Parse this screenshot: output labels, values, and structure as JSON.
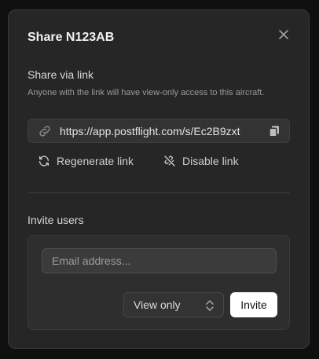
{
  "dialog": {
    "title": "Share N123AB",
    "close_icon": "close-icon"
  },
  "share_link": {
    "heading": "Share via link",
    "description": "Anyone with the link will have view-only access to this aircraft.",
    "url": "https://app.postflight.com/s/Ec2B9zxt",
    "link_icon": "link-icon",
    "copy_icon": "copy-icon",
    "regenerate_label": "Regenerate link",
    "regenerate_icon": "refresh-icon",
    "disable_label": "Disable link",
    "disable_icon": "link-off-icon"
  },
  "invite": {
    "heading": "Invite users",
    "email_placeholder": "Email address...",
    "email_value": "",
    "permission_selected": "View only",
    "permission_icon": "chevron-up-down-icon",
    "invite_label": "Invite"
  },
  "colors": {
    "background": "#0f0f0f",
    "modal": "#262626",
    "panel": "#2e2e2e",
    "primary_button": "#ffffff"
  }
}
